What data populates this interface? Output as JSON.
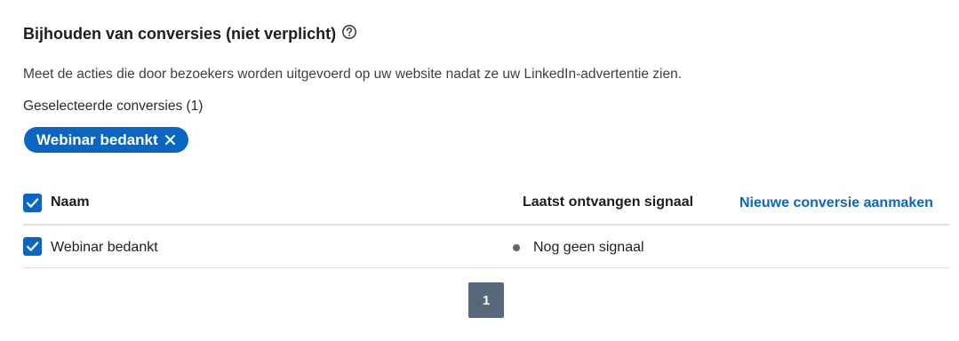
{
  "section": {
    "title": "Bijhouden van conversies (niet verplicht)",
    "help_icon": "question-circle-icon",
    "description": "Meet de acties die door bezoekers worden uitgevoerd op uw website nadat ze uw LinkedIn-advertentie zien.",
    "selected_label": "Geselecteerde conversies (1)"
  },
  "selected_pills": [
    {
      "label": "Webinar bedankt",
      "remove_icon": "close-icon"
    }
  ],
  "table": {
    "header": {
      "name": "Naam",
      "last_signal": "Laatst ontvangen signaal",
      "create_link": "Nieuwe conversie aanmaken",
      "select_all_checked": true
    },
    "rows": [
      {
        "name": "Webinar bedankt",
        "signal": "Nog geen signaal",
        "checked": true
      }
    ]
  },
  "pagination": {
    "current_page": "1"
  },
  "colors": {
    "accent": "#0a66c2",
    "pagination_bg": "#56687a",
    "status_dot": "#666666",
    "divider": "#e0e0e0"
  }
}
